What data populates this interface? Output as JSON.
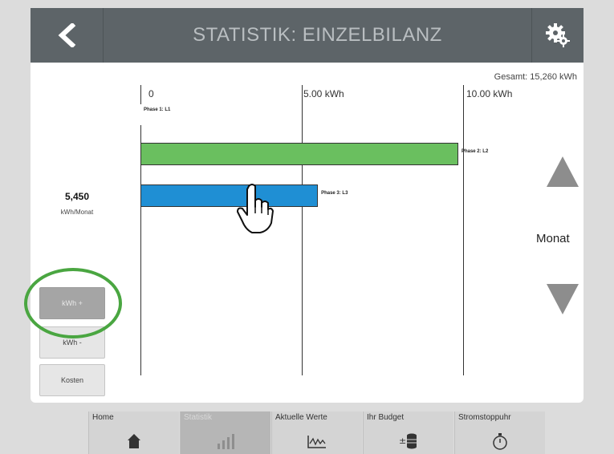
{
  "header": {
    "title": "STATISTIK: EINZELBILANZ",
    "back_icon": "chevron-left-icon",
    "settings_icon": "gear-icon"
  },
  "chart": {
    "total_label": "Gesamt: 15,260 kWh",
    "ticks": [
      "0",
      "5.00 kWh",
      "10.00 kWh"
    ]
  },
  "chart_data": {
    "type": "bar",
    "orientation": "horizontal",
    "categories": [
      "Phase 1: L1",
      "Phase 2: L2",
      "Phase 3: L3"
    ],
    "values": [
      0.0,
      9.8,
      5.45
    ],
    "colors": [
      "#ffffff",
      "#6abf5f",
      "#1f8fd4"
    ],
    "xlim": [
      0,
      10
    ],
    "grid": true
  },
  "readout": {
    "value": "5,450",
    "unit": "kWh/Monat"
  },
  "side_buttons": {
    "kwh_plus": "kWh +",
    "kwh_minus": "kWh -",
    "kosten": "Kosten"
  },
  "period": {
    "label": "Monat"
  },
  "tabs": [
    {
      "label": "Home",
      "icon": "home-icon"
    },
    {
      "label": "Statistik",
      "icon": "bar-chart-icon"
    },
    {
      "label": "Aktuelle Werte",
      "icon": "waveform-icon"
    },
    {
      "label": "Ihr Budget",
      "icon": "coins-icon"
    },
    {
      "label": "Stromstoppuhr",
      "icon": "stopwatch-icon"
    }
  ],
  "colors": {
    "header_bg": "#5d6468",
    "accent_green": "#4aa641",
    "bar_green": "#6abf5f",
    "bar_blue": "#1f8fd4"
  }
}
